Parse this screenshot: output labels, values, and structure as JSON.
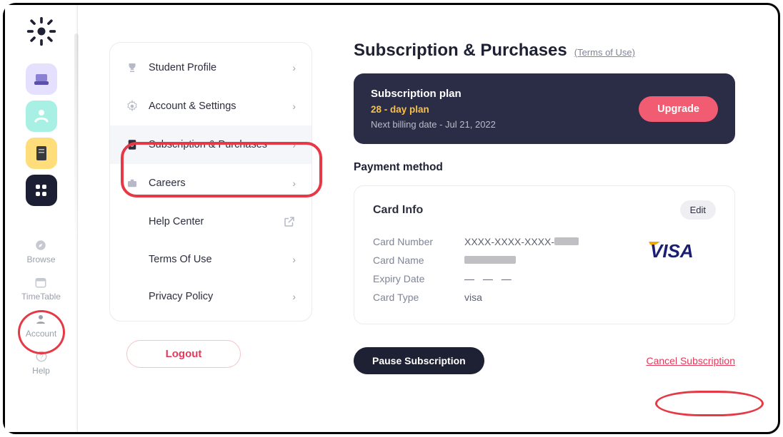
{
  "rail": {
    "items": [
      {
        "label": "Browse"
      },
      {
        "label": "TimeTable"
      },
      {
        "label": "Account"
      },
      {
        "label": "Help"
      }
    ]
  },
  "menu": {
    "items": [
      {
        "label": "Student Profile"
      },
      {
        "label": "Account & Settings"
      },
      {
        "label": "Subscription & Purchases"
      },
      {
        "label": "Careers"
      },
      {
        "label": "Help Center"
      },
      {
        "label": "Terms Of Use"
      },
      {
        "label": "Privacy Policy"
      }
    ],
    "logout_label": "Logout"
  },
  "page": {
    "title": "Subscription & Purchases",
    "terms_label": "(Terms of Use)"
  },
  "plan": {
    "heading": "Subscription plan",
    "duration": "28 - day plan",
    "next": "Next billing date - Jul 21, 2022",
    "upgrade_label": "Upgrade"
  },
  "payment": {
    "section_heading": "Payment method",
    "card_heading": "Card Info",
    "edit_label": "Edit",
    "rows": {
      "number_label": "Card Number",
      "number_value": "XXXX-XXXX-XXXX-",
      "name_label": "Card Name",
      "expiry_label": "Expiry Date",
      "expiry_value": "— — —",
      "type_label": "Card Type",
      "type_value": "visa"
    },
    "brand": "VISA"
  },
  "actions": {
    "pause_label": "Pause Subscription",
    "cancel_label": "Cancel Subscription"
  }
}
